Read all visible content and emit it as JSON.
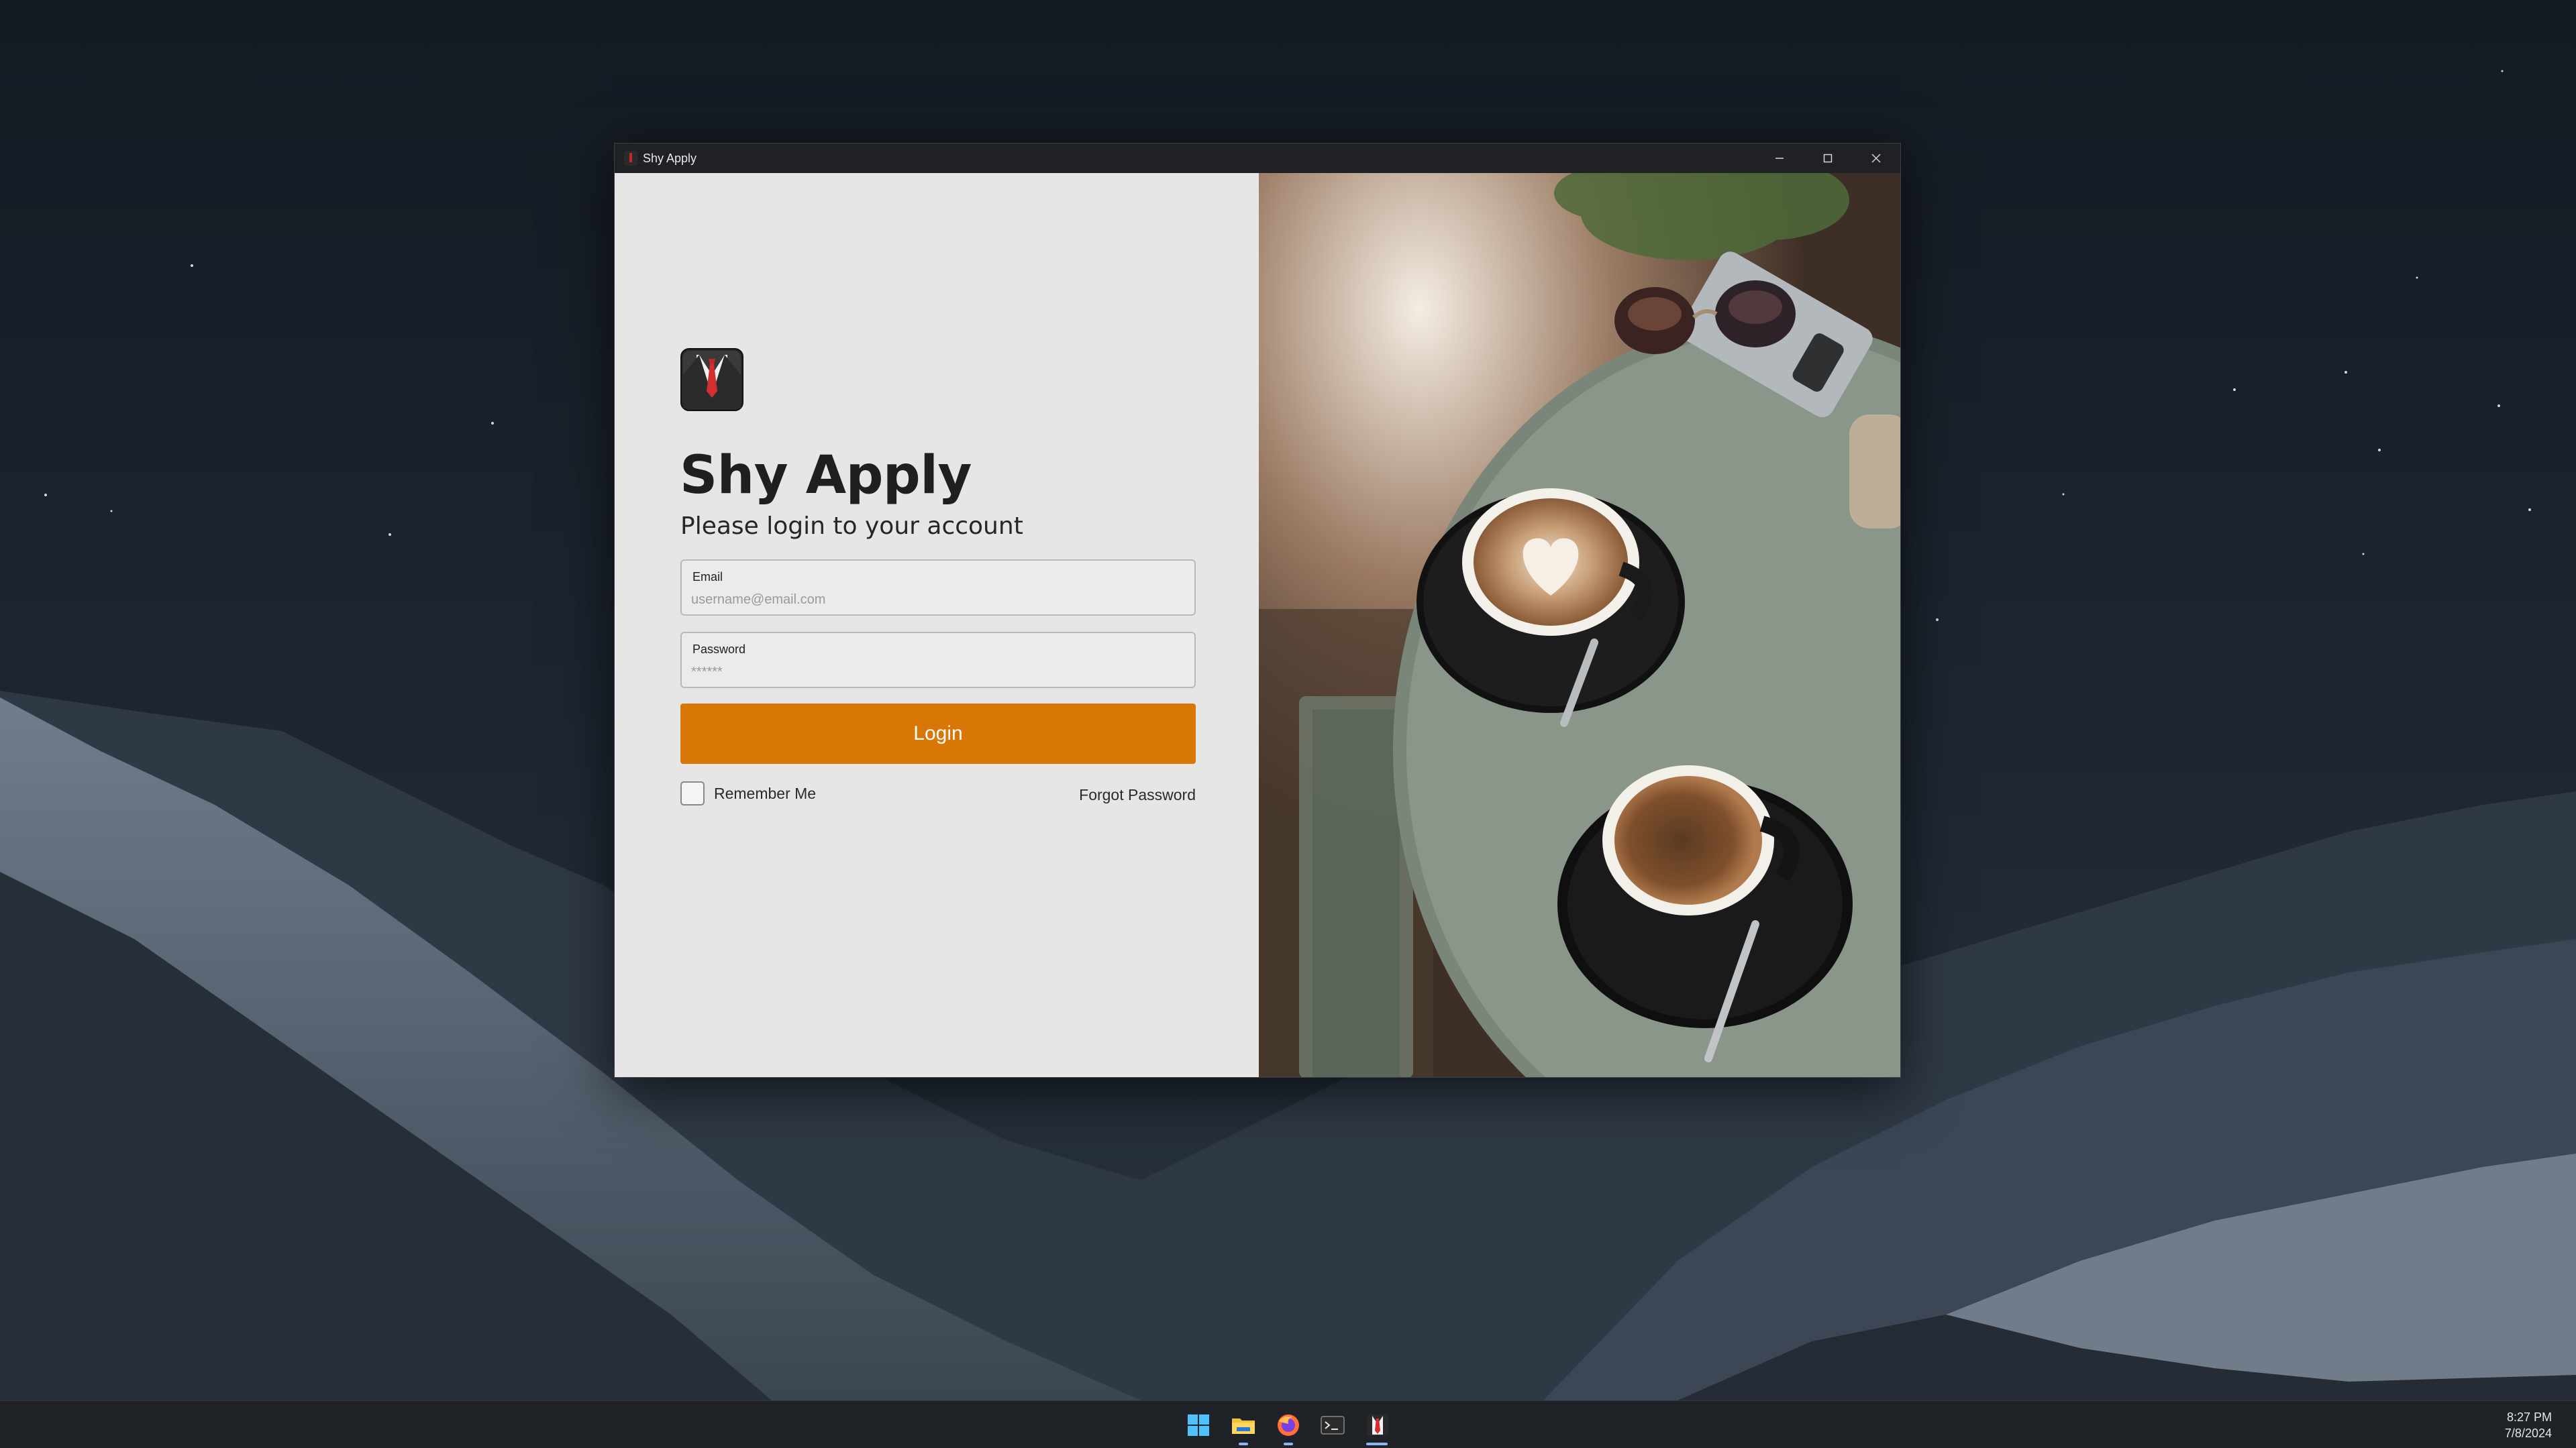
{
  "window": {
    "title": "Shy Apply"
  },
  "login": {
    "heading": "Shy Apply",
    "subheading": "Please login to your account",
    "email_label": "Email",
    "email_placeholder": "username@email.com",
    "password_label": "Password",
    "password_placeholder": "******",
    "login_button": "Login",
    "remember_me": "Remember Me",
    "forgot_password": "Forgot Password"
  },
  "colors": {
    "accent": "#d97706",
    "titlebar": "#202124",
    "pane_background": "#e6e6e6"
  },
  "taskbar": {
    "icons": [
      "windows-start-icon",
      "file-explorer-icon",
      "firefox-icon",
      "terminal-icon",
      "shy-apply-icon"
    ],
    "time": "8:27 PM",
    "date": "7/8/2024"
  }
}
